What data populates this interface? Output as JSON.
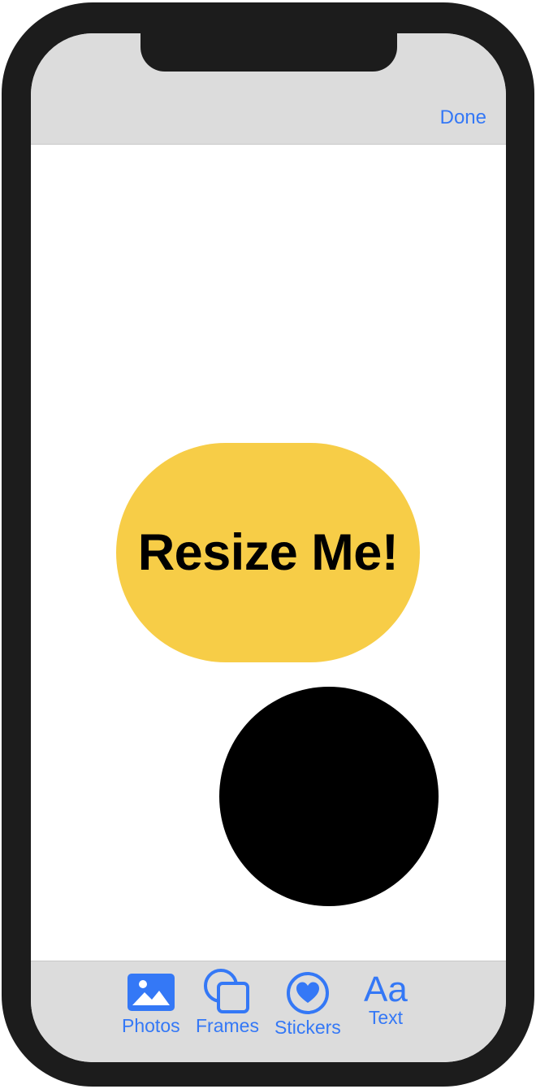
{
  "header": {
    "done_label": "Done"
  },
  "canvas": {
    "text_sticker": {
      "label": "Resize Me!",
      "color": "#f7cd47"
    },
    "circle_sticker": {
      "color": "#000000"
    }
  },
  "toolbar": {
    "accent_color": "#3478f6",
    "items": [
      {
        "label": "Photos",
        "icon": "photo-icon"
      },
      {
        "label": "Frames",
        "icon": "frames-icon"
      },
      {
        "label": "Stickers",
        "icon": "heart-circle-icon"
      },
      {
        "label": "Text",
        "icon": "text-icon",
        "glyph": "Aa"
      }
    ]
  }
}
